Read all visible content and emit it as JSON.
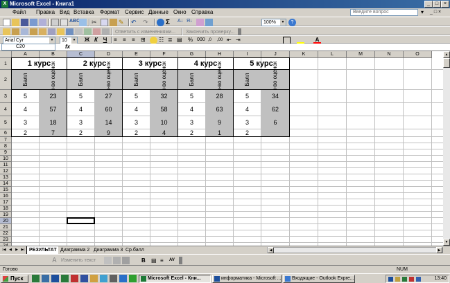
{
  "window": {
    "title": "Microsoft Excel - Книга1"
  },
  "menu": {
    "items": [
      "Файл",
      "Правка",
      "Вид",
      "Вставка",
      "Формат",
      "Сервис",
      "Данные",
      "Окно",
      "Справка"
    ],
    "help_placeholder": "Введите вопрос"
  },
  "toolbar": {
    "zoom": "100%",
    "reply_label": "Ответить с изменениями...",
    "end_review_label": "Закончить проверку...",
    "font_name": "Arial Cyr",
    "font_size": "10",
    "bold": "Ж",
    "italic": "К",
    "underline": "Ч",
    "percent": "%",
    "thousands": "000"
  },
  "formula_bar": {
    "name_box": "C20",
    "fx": "fx",
    "content": ""
  },
  "columns": [
    "A",
    "B",
    "C",
    "D",
    "E",
    "F",
    "G",
    "H",
    "I",
    "J",
    "K",
    "L",
    "M",
    "N",
    "O"
  ],
  "rows": [
    "1",
    "2",
    "3",
    "4",
    "5",
    "6",
    "7",
    "8",
    "9",
    "10",
    "11",
    "12",
    "13",
    "14",
    "15",
    "16",
    "17",
    "18",
    "19",
    "20",
    "21",
    "22",
    "23",
    "24"
  ],
  "selected_column": "C",
  "selected_row": "20",
  "table": {
    "courses": [
      "1 курс",
      "2 курс",
      "3 курс",
      "4 курс",
      "5 курс"
    ],
    "sub_headers": [
      "Балл",
      "Кол-во оценок"
    ],
    "data": [
      [
        "5",
        "23",
        "5",
        "27",
        "5",
        "32",
        "5",
        "28",
        "5",
        "34"
      ],
      [
        "4",
        "57",
        "4",
        "60",
        "4",
        "58",
        "4",
        "63",
        "4",
        "62"
      ],
      [
        "3",
        "18",
        "3",
        "14",
        "3",
        "10",
        "3",
        "9",
        "3",
        "6"
      ],
      [
        "2",
        "7",
        "2",
        "9",
        "2",
        "4",
        "2",
        "1",
        "2",
        ""
      ]
    ]
  },
  "sheets": {
    "tabs": [
      "РЕЗУЛЬТАТ",
      "Диаграмма 2",
      "Диаграмма 3",
      "Ср.балл"
    ],
    "active": "РЕЗУЛЬТАТ"
  },
  "drawing": {
    "text_label": "Изменить текст"
  },
  "status": {
    "ready": "Готово",
    "num": "NUM"
  },
  "taskbar": {
    "start": "Пуск",
    "tasks": [
      "Microsoft Excel - Кни...",
      "информатика - Microsoft ...",
      "Входящие - Outlook Expre..."
    ],
    "clock": "13:40"
  },
  "colors": {
    "title_bar": "#0a246a",
    "header_fill": "#c0c0c0",
    "selection": "#b6bdd2"
  }
}
